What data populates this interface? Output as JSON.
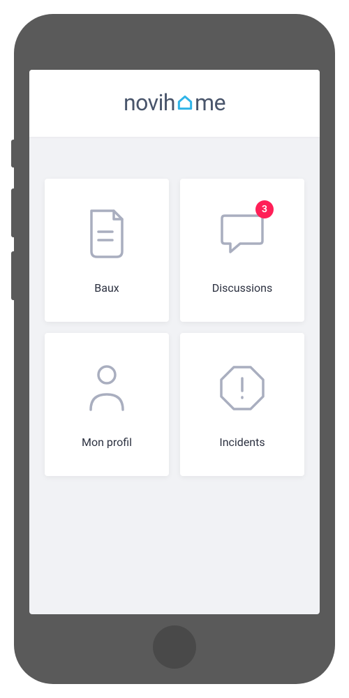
{
  "brand": {
    "name_part1": "novih",
    "name_part2": "me",
    "accent_color": "#2fb4e8"
  },
  "tiles": [
    {
      "id": "baux",
      "label": "Baux",
      "icon": "document-icon",
      "badge": null
    },
    {
      "id": "discussions",
      "label": "Discussions",
      "icon": "chat-icon",
      "badge": "3"
    },
    {
      "id": "profil",
      "label": "Mon profil",
      "icon": "profile-icon",
      "badge": null
    },
    {
      "id": "incidents",
      "label": "Incidents",
      "icon": "alert-icon",
      "badge": null
    }
  ],
  "colors": {
    "badge_bg": "#ff1f57",
    "icon_stroke": "#a9aebf",
    "text": "#2c3140"
  }
}
